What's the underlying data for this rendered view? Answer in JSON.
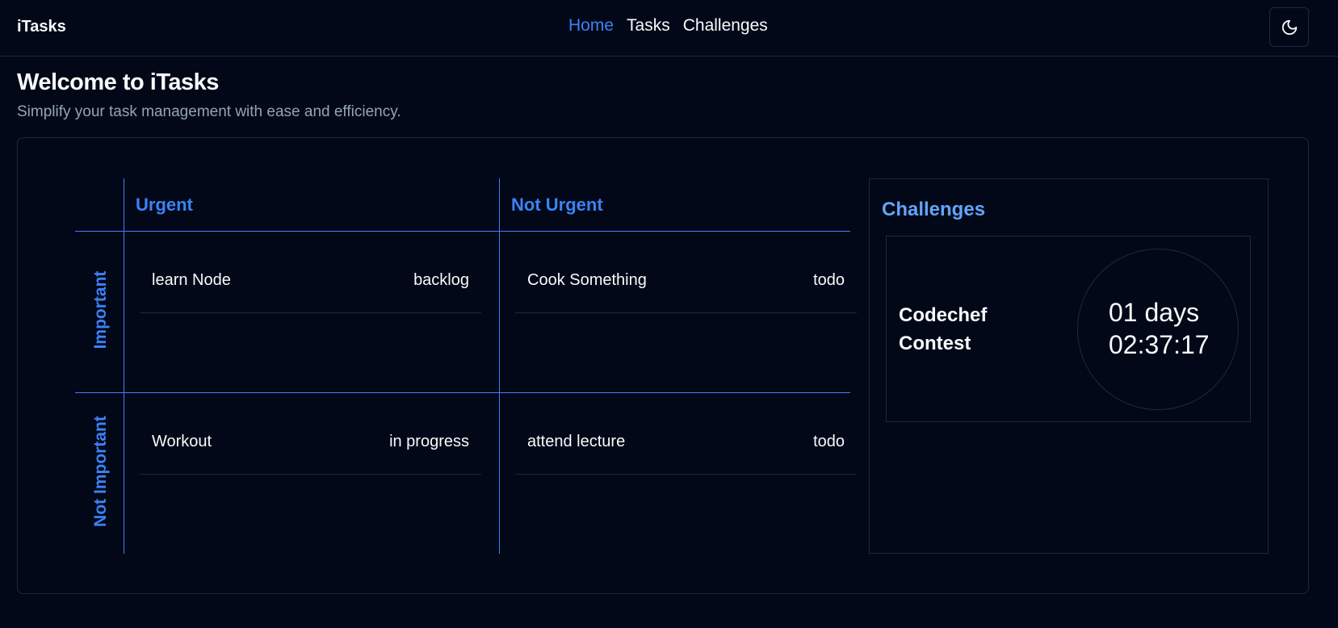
{
  "header": {
    "brand": "iTasks",
    "nav": [
      {
        "label": "Home",
        "active": true
      },
      {
        "label": "Tasks",
        "active": false
      },
      {
        "label": "Challenges",
        "active": false
      }
    ],
    "theme_icon": "moon-icon"
  },
  "page": {
    "title": "Welcome to iTasks",
    "subtitle": "Simplify your task management with ease and efficiency."
  },
  "matrix": {
    "columns": [
      "Urgent",
      "Not Urgent"
    ],
    "rows": [
      "Important",
      "Not Important"
    ],
    "tasks": {
      "important_urgent": [
        {
          "name": "learn Node",
          "status": "backlog"
        }
      ],
      "important_not_urgent": [
        {
          "name": "Cook Something",
          "status": "todo"
        }
      ],
      "not_important_urgent": [
        {
          "name": "Workout",
          "status": "in progress"
        }
      ],
      "not_important_not_urgent": [
        {
          "name": "attend lecture",
          "status": "todo"
        }
      ]
    }
  },
  "challenges": {
    "title": "Challenges",
    "items": [
      {
        "name": "Codechef Contest",
        "days": "01 days",
        "time": "02:37:17"
      }
    ]
  },
  "colors": {
    "background": "#020817",
    "accent": "#3b82f6",
    "challenge_title": "#60a5fa",
    "border": "#1e293b",
    "muted_text": "#94a3b8"
  }
}
